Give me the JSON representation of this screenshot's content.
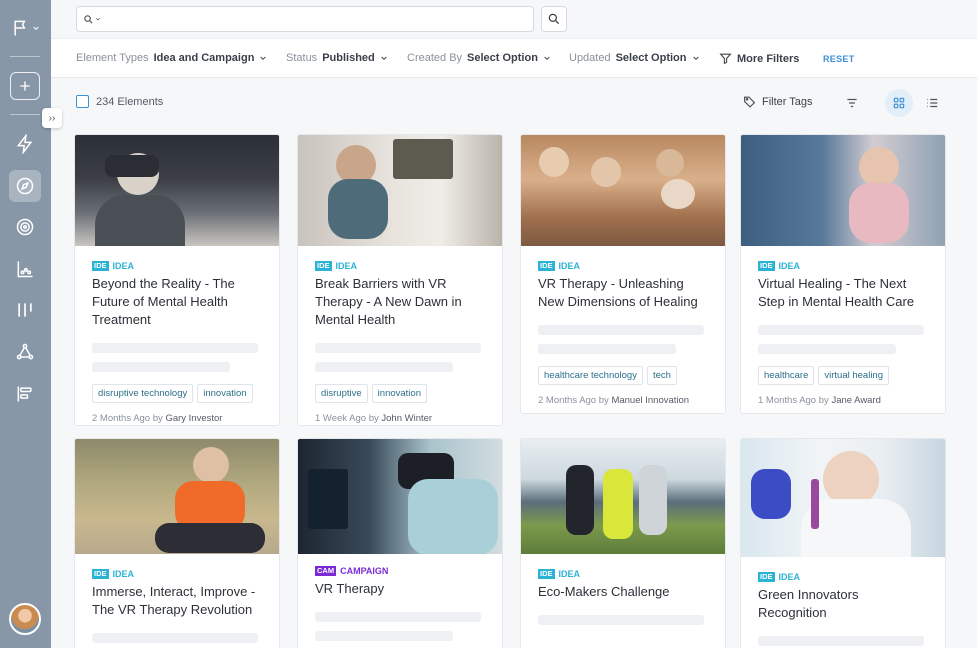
{
  "search": {
    "placeholder": ""
  },
  "filters": [
    {
      "label": "Element Types",
      "value": "Idea and Campaign"
    },
    {
      "label": "Status",
      "value": "Published"
    },
    {
      "label": "Created By",
      "value": "Select Option"
    },
    {
      "label": "Updated",
      "value": "Select Option"
    }
  ],
  "more_filters_label": "More Filters",
  "reset_label": "RESET",
  "element_count": "234 Elements",
  "filter_tags_label": "Filter Tags",
  "cards": [
    {
      "badge": "IDE",
      "type": "IDEA",
      "title": "Beyond the Reality - The Future of Mental Health Treatment",
      "tags": [
        "disruptive technology",
        "innovation"
      ],
      "meta_time": "2 Months Ago",
      "meta_by": "by",
      "author": "Gary Investor"
    },
    {
      "badge": "IDE",
      "type": "IDEA",
      "title": "Break Barriers with VR Therapy - A New Dawn in Mental Health",
      "tags": [
        "disruptive",
        "innovation"
      ],
      "meta_time": "1 Week Ago",
      "meta_by": "by",
      "author": "John Winter"
    },
    {
      "badge": "IDE",
      "type": "IDEA",
      "title": "VR Therapy - Unleashing New Dimensions of Healing",
      "tags": [
        "healthcare technology",
        "tech"
      ],
      "meta_time": "2 Months Ago",
      "meta_by": "by",
      "author": "Manuel Innovation"
    },
    {
      "badge": "IDE",
      "type": "IDEA",
      "title": "Virtual Healing - The Next Step in Mental Health Care",
      "tags": [
        "healthcare",
        "virtual healing"
      ],
      "meta_time": "1 Months Ago",
      "meta_by": "by",
      "author": "Jane Award"
    },
    {
      "badge": "IDE",
      "type": "IDEA",
      "title": "Immerse, Interact, Improve - The VR Therapy Revolution"
    },
    {
      "badge": "CAM",
      "type": "CAMPAIGN",
      "title": "VR Therapy"
    },
    {
      "badge": "IDE",
      "type": "IDEA",
      "title": "Eco-Makers Challenge"
    },
    {
      "badge": "IDE",
      "type": "IDEA",
      "title": "Green Innovators Recognition"
    }
  ],
  "colors": {
    "sidebar": "#8797a8",
    "accent": "#3d8fd6",
    "idea": "#2bb3d6",
    "campaign": "#7b2bd6"
  },
  "icons": [
    "flag-icon",
    "plus-icon",
    "lightning-icon",
    "compass-icon",
    "target-icon",
    "bar-chart-icon",
    "columns-icon",
    "network-icon",
    "align-icon"
  ]
}
